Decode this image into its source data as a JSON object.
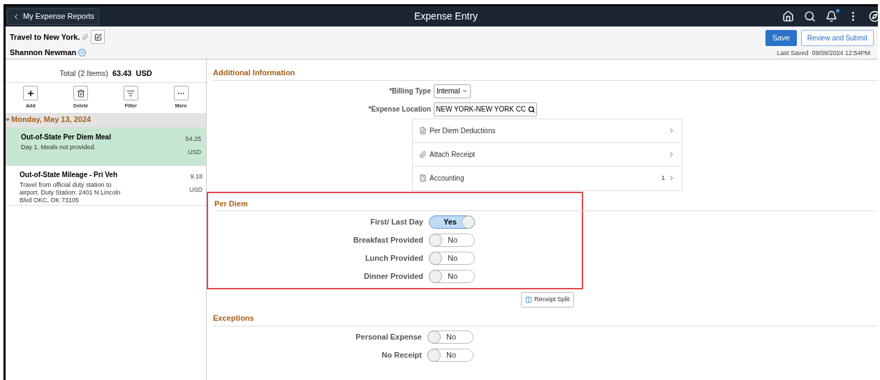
{
  "header": {
    "back_button": "My Expense Reports",
    "title": "Expense Entry",
    "notification_dot": true
  },
  "report": {
    "name": "Travel to New York.",
    "owner": "Shannon Newman"
  },
  "actions": {
    "save": "Save",
    "submit": "Review and Submit",
    "last_saved_label": "Last Saved",
    "last_saved": "09/09/2024 12:54PM"
  },
  "summary": {
    "label": "Total (2 Items)",
    "amount": "63.43",
    "currency": "USD"
  },
  "toolbar": [
    {
      "label": "Add",
      "kind": "add"
    },
    {
      "label": "Delete",
      "kind": "delete"
    },
    {
      "label": "Filter",
      "kind": "filter"
    },
    {
      "label": "More",
      "kind": "more"
    }
  ],
  "date_group": {
    "label": "Monday, May 13, 2024",
    "expanded": true
  },
  "expenses": [
    {
      "title": "Out-of-State Per Diem Meal",
      "description": "Day 1. Meals not provided.",
      "amount": "54.25",
      "currency": "USD",
      "selected": true
    },
    {
      "title": "Out-of-State Mileage - Pri Veh",
      "description": "Travel from official duty station to airport. Duty Station: 2401 N Lincoln Blvd OKC, OK 73105",
      "amount": "9.18",
      "currency": "USD",
      "selected": false
    }
  ],
  "additional_information": {
    "heading": "Additional Information",
    "billing_type": {
      "label": "*Billing Type",
      "value": "Internal"
    },
    "expense_location": {
      "label": "*Expense Location",
      "value": "NEW YORK-NEW YORK CC"
    },
    "links": [
      {
        "label": "Per Diem Deductions",
        "kind": "list"
      },
      {
        "label": "Attach Receipt",
        "kind": "clip"
      },
      {
        "label": "Accounting",
        "kind": "accounting",
        "count": "1"
      }
    ]
  },
  "per_diem": {
    "heading": "Per Diem",
    "highlighted": true,
    "toggles": [
      {
        "label": "First/ Last Day",
        "on": true,
        "text": "Yes"
      },
      {
        "label": "Breakfast Provided",
        "on": false,
        "text": "No"
      },
      {
        "label": "Lunch Provided",
        "on": false,
        "text": "No"
      },
      {
        "label": "Dinner Provided",
        "on": false,
        "text": "No"
      }
    ]
  },
  "receipt_split": "Receipt Split",
  "exceptions": {
    "heading": "Exceptions",
    "toggles": [
      {
        "label": "Personal Expense",
        "on": false,
        "text": "No"
      },
      {
        "label": "No Receipt",
        "on": false,
        "text": "No"
      }
    ]
  }
}
